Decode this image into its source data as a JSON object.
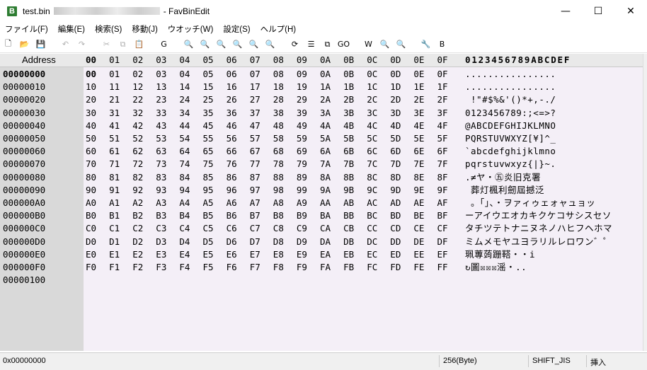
{
  "window": {
    "file_name": "test.bin",
    "app_name": "- FavBinEdit",
    "app_icon_letter": "B",
    "minimize": "—",
    "maximize": "☐",
    "close": "✕"
  },
  "menu": [
    "ファイル(F)",
    "編集(E)",
    "検索(S)",
    "移動(J)",
    "ウオッチ(W)",
    "設定(S)",
    "ヘルプ(H)"
  ],
  "toolbar": [
    {
      "icon": "new-file-icon",
      "glyph": "🗋"
    },
    {
      "icon": "open-folder-icon",
      "glyph": "📂"
    },
    {
      "icon": "save-icon",
      "glyph": "💾"
    },
    {
      "icon": "undo-icon",
      "glyph": "↶"
    },
    {
      "icon": "redo-icon",
      "glyph": "↷"
    },
    {
      "icon": "cut-icon",
      "glyph": "✂"
    },
    {
      "icon": "copy-icon",
      "glyph": "⧉"
    },
    {
      "icon": "paste-icon",
      "glyph": "📋"
    },
    {
      "icon": "goto-icon",
      "glyph": "G"
    },
    {
      "icon": "search-icon",
      "glyph": "🔍"
    },
    {
      "icon": "search-next-icon",
      "glyph": "🔍"
    },
    {
      "icon": "search-prev-icon",
      "glyph": "🔍"
    },
    {
      "icon": "search-hex-icon",
      "glyph": "🔍"
    },
    {
      "icon": "search-hex-next-icon",
      "glyph": "🔍"
    },
    {
      "icon": "search-hex-prev-icon",
      "glyph": "🔍"
    },
    {
      "icon": "replace-icon",
      "glyph": "⟳"
    },
    {
      "icon": "list-icon",
      "glyph": "☰"
    },
    {
      "icon": "compare-icon",
      "glyph": "⧉"
    },
    {
      "icon": "goto-address-icon",
      "glyph": "GO"
    },
    {
      "icon": "watch-icon",
      "glyph": "W"
    },
    {
      "icon": "watch-search-icon",
      "glyph": "🔍"
    },
    {
      "icon": "watch-search2-icon",
      "glyph": "🔍"
    },
    {
      "icon": "settings-icon",
      "glyph": "🔧"
    },
    {
      "icon": "about-icon",
      "glyph": "B"
    }
  ],
  "header": {
    "address_label": "Address",
    "hex_columns": [
      "00",
      "01",
      "02",
      "03",
      "04",
      "05",
      "06",
      "07",
      "08",
      "09",
      "0A",
      "0B",
      "0C",
      "0D",
      "0E",
      "0F"
    ],
    "ascii_header": "0123456789ABCDEF"
  },
  "rows": [
    {
      "address": "00000000",
      "ascii": "................"
    },
    {
      "address": "00000010",
      "ascii": "................"
    },
    {
      "address": "00000020",
      "ascii": " !\"#$%&'()*+,-./"
    },
    {
      "address": "00000030",
      "ascii": "0123456789:;<=>?"
    },
    {
      "address": "00000040",
      "ascii": "@ABCDEFGHIJKLMNO"
    },
    {
      "address": "00000050",
      "ascii": "PQRSTUVWXYZ[¥]^_"
    },
    {
      "address": "00000060",
      "ascii": "`abcdefghijklmno"
    },
    {
      "address": "00000070",
      "ascii": "pqrstuvwxyz{|}~."
    },
    {
      "address": "00000080",
      "ascii": ".≠ヤ・㊄炎旧克署"
    },
    {
      "address": "00000090",
      "ascii": " 葬灯楓利劒屆撼泛"
    },
    {
      "address": "000000A0",
      "ascii": " 。「」、・ヲァィゥェォャュョッ"
    },
    {
      "address": "000000B0",
      "ascii": "ーアイウエオカキクケコサシスセソ"
    },
    {
      "address": "000000C0",
      "ascii": "タチツテトナニヌネノハヒフヘホマ"
    },
    {
      "address": "000000D0",
      "ascii": "ミムメモヤユヨラリルレロワン゛゜"
    },
    {
      "address": "000000E0",
      "ascii": "珮蓴蒟跚鞳・・i"
    },
    {
      "address": "000000F0",
      "ascii": "↻圖☒☒☒滛・.."
    },
    {
      "address": "00000100",
      "ascii": ""
    }
  ],
  "status": {
    "offset": "0x00000000",
    "size": "256(Byte)",
    "encoding": "SHIFT_JIS",
    "mode": "挿入"
  }
}
